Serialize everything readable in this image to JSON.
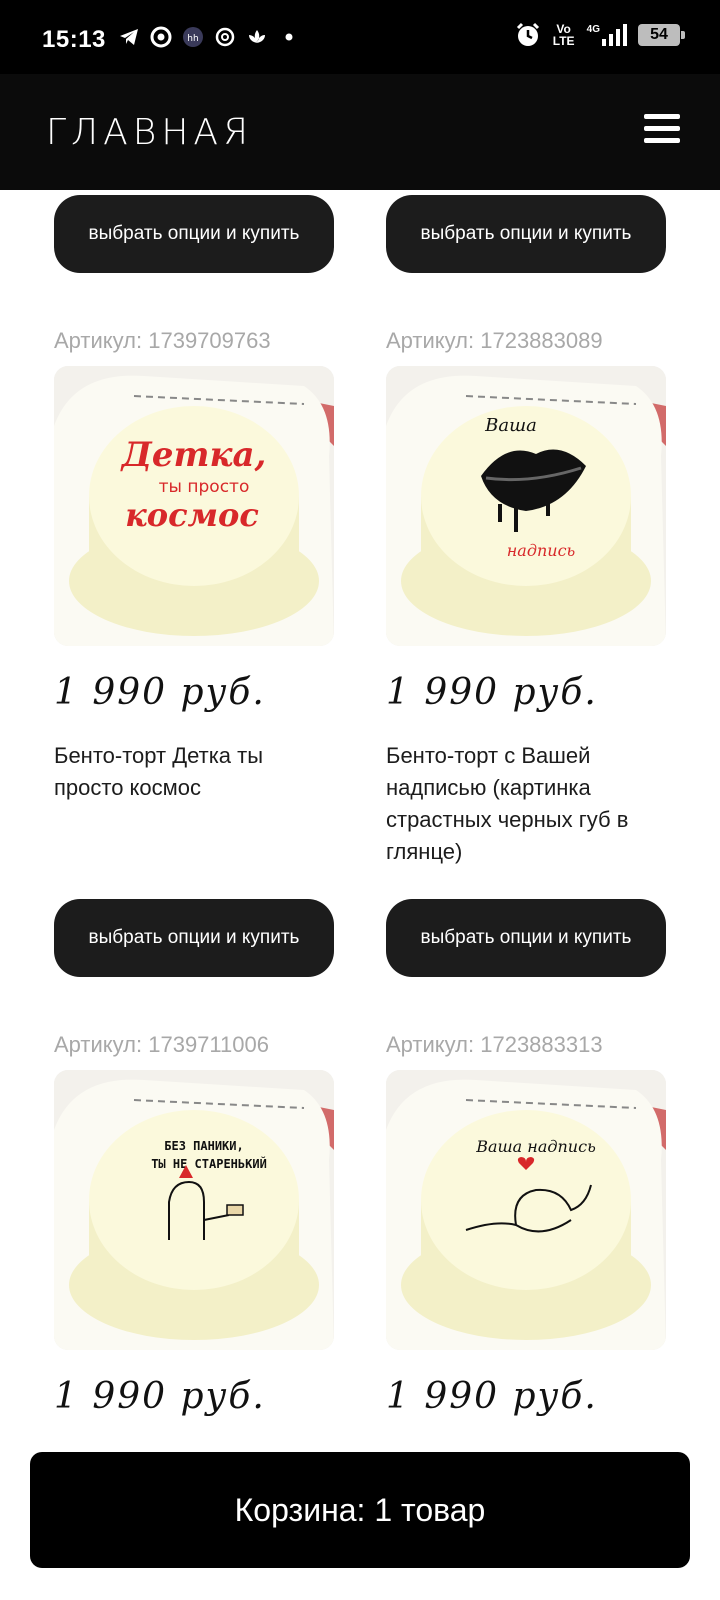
{
  "status_bar": {
    "time": "15:13",
    "volte": "Vo LTE",
    "network": "4G",
    "battery": "54"
  },
  "header": {
    "logo": "ГЛАВНАЯ",
    "menu_icon": "hamburger-menu-icon"
  },
  "catalog": {
    "top_buttons": [
      "выбрать опции и купить",
      "выбрать опции и купить"
    ],
    "products": [
      {
        "sku": "Артикул: 1739709763",
        "image_text": [
          "Детка,",
          "ты просто",
          "космос"
        ],
        "price": "1 990 руб.",
        "title": "Бенто-торт Детка ты просто космос",
        "button": "выбрать опции и купить"
      },
      {
        "sku": "Артикул: 1723883089",
        "image_text": [
          "Ваша",
          "надпись"
        ],
        "price": "1 990 руб.",
        "title": "Бенто-торт с Вашей надписью (картинка страстных черных губ в глянце)",
        "button": "выбрать опции и купить"
      },
      {
        "sku": "Артикул: 1739711006",
        "image_text": [
          "БЕЗ ПАНИКИ,",
          "ТЫ НЕ СТАРЕНЬКИЙ"
        ],
        "price": "1 990 руб."
      },
      {
        "sku": "Артикул: 1723883313",
        "image_text": [
          "Ваша надпись"
        ],
        "price": "1 990 руб."
      }
    ]
  },
  "cart": {
    "label": "Корзина: 1 товар"
  },
  "colors": {
    "header_bg": "#0b0b0b",
    "button_bg": "#1c1c1c",
    "sku_text": "#a8a8a8",
    "cake_text_red": "#d8282a"
  }
}
